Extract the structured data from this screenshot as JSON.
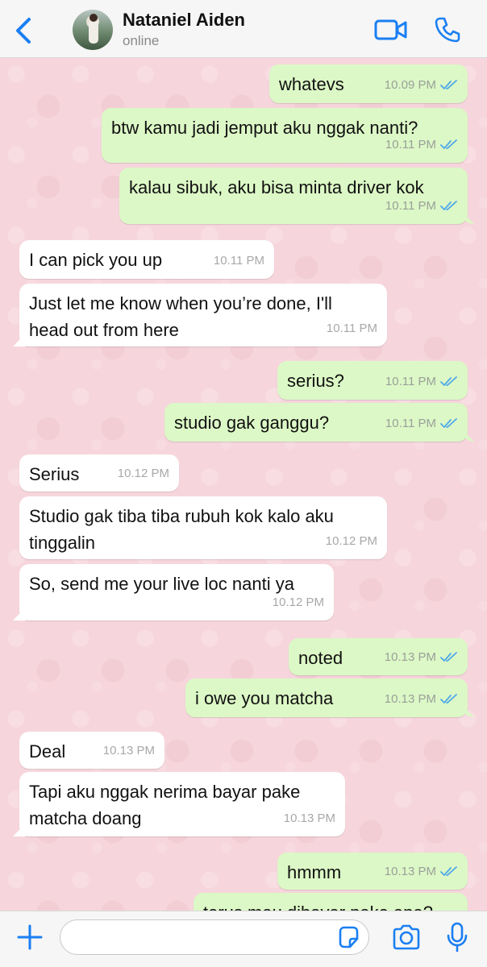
{
  "header": {
    "contact_name": "Nataniel Aiden",
    "status": "online"
  },
  "colors": {
    "accent": "#1a7ff2",
    "outgoing_bubble": "#dcf8c6",
    "incoming_bubble": "#ffffff",
    "wallpaper": "#f6d6dc",
    "read_ticks": "#4fa8e8"
  },
  "icons": {
    "back": "chevron-left-icon",
    "video": "video-camera-icon",
    "call": "phone-icon",
    "plus": "plus-icon",
    "sticker": "sticker-icon",
    "camera": "camera-icon",
    "mic": "microphone-icon"
  },
  "messages": [
    {
      "direction": "out",
      "text": "whatevs",
      "time": "10.09 PM",
      "read": true
    },
    {
      "direction": "out",
      "text": "btw kamu jadi jemput aku nggak nanti?",
      "time": "10.11 PM",
      "read": true
    },
    {
      "direction": "out",
      "text": "kalau sibuk, aku bisa minta driver kok",
      "time": "10.11 PM",
      "read": true
    },
    {
      "direction": "in",
      "text": "I can pick you up",
      "time": "10.11 PM"
    },
    {
      "direction": "in",
      "text": "Just let me know when you’re done, I'll\nhead out from here",
      "time": "10.11 PM"
    },
    {
      "direction": "out",
      "text": "serius?",
      "time": "10.11 PM",
      "read": true
    },
    {
      "direction": "out",
      "text": "studio gak ganggu?",
      "time": "10.11 PM",
      "read": true
    },
    {
      "direction": "in",
      "text": "Serius",
      "time": "10.12 PM"
    },
    {
      "direction": "in",
      "text": "Studio gak tiba tiba rubuh kok kalo aku\ntinggalin",
      "time": "10.12 PM"
    },
    {
      "direction": "in",
      "text": "So, send me your live loc nanti ya",
      "time": "10.12 PM"
    },
    {
      "direction": "out",
      "text": "noted",
      "time": "10.13 PM",
      "read": true
    },
    {
      "direction": "out",
      "text": "i owe you matcha",
      "time": "10.13 PM",
      "read": true
    },
    {
      "direction": "in",
      "text": "Deal",
      "time": "10.13 PM"
    },
    {
      "direction": "in",
      "text": "Tapi aku nggak nerima bayar pake\nmatcha doang",
      "time": "10.13 PM"
    },
    {
      "direction": "out",
      "text": "hmmm",
      "time": "10.13 PM",
      "read": true
    },
    {
      "direction": "out",
      "text": "terus mau dibayar pake apa?",
      "time": "",
      "read": true
    }
  ],
  "composer": {
    "value": ""
  }
}
